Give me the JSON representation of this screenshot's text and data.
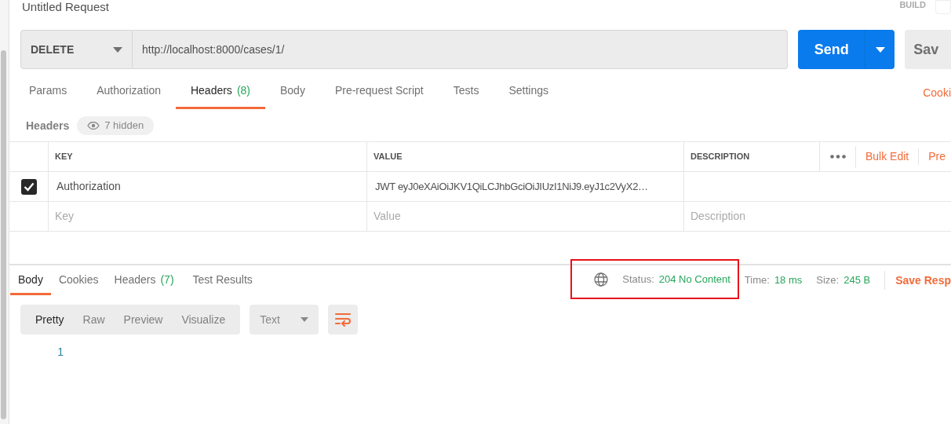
{
  "request": {
    "title": "Untitled Request",
    "build_label": "BUILD",
    "method": "DELETE",
    "url": "http://localhost:8000/cases/1/",
    "send": "Send",
    "save": "Sav"
  },
  "request_tabs": [
    {
      "label": "Params",
      "selected": false
    },
    {
      "label": "Authorization",
      "selected": false
    },
    {
      "label": "Headers",
      "count": "(8)",
      "selected": true
    },
    {
      "label": "Body",
      "selected": false
    },
    {
      "label": "Pre-request Script",
      "selected": false
    },
    {
      "label": "Tests",
      "selected": false
    },
    {
      "label": "Settings",
      "selected": false
    }
  ],
  "cookies_link": "Cooki",
  "headers": {
    "title": "Headers",
    "hidden": "7 hidden",
    "columns": [
      "KEY",
      "VALUE",
      "DESCRIPTION"
    ],
    "bulk_edit": "Bulk Edit",
    "presets": "Pre",
    "rows": [
      {
        "checked": true,
        "key": "Authorization",
        "value": "JWT eyJ0eXAiOiJKV1QiLCJhbGciOiJIUzI1NiJ9.eyJ1c2VyX2…",
        "description": ""
      }
    ],
    "new_row": [
      {
        "placeholder": "Key"
      },
      {
        "placeholder": "Value"
      },
      {
        "placeholder": "Description"
      }
    ]
  },
  "response_tabs": [
    {
      "label": "Body",
      "selected": true
    },
    {
      "label": "Cookies",
      "selected": false
    },
    {
      "label": "Headers",
      "count": "(7)",
      "selected": false
    },
    {
      "label": "Test Results",
      "selected": false
    }
  ],
  "response_meta": {
    "status_label": "Status:",
    "status": "204 No Content",
    "time_label": "Time:",
    "time": "18 ms",
    "size_label": "Size:",
    "size": "245 B",
    "save_response": "Save Resp"
  },
  "view_modes": [
    {
      "label": "Pretty",
      "selected": true
    },
    {
      "label": "Raw",
      "selected": false
    },
    {
      "label": "Preview",
      "selected": false
    },
    {
      "label": "Visualize",
      "selected": false
    }
  ],
  "format": "Text",
  "line_numbers": [
    "1"
  ]
}
